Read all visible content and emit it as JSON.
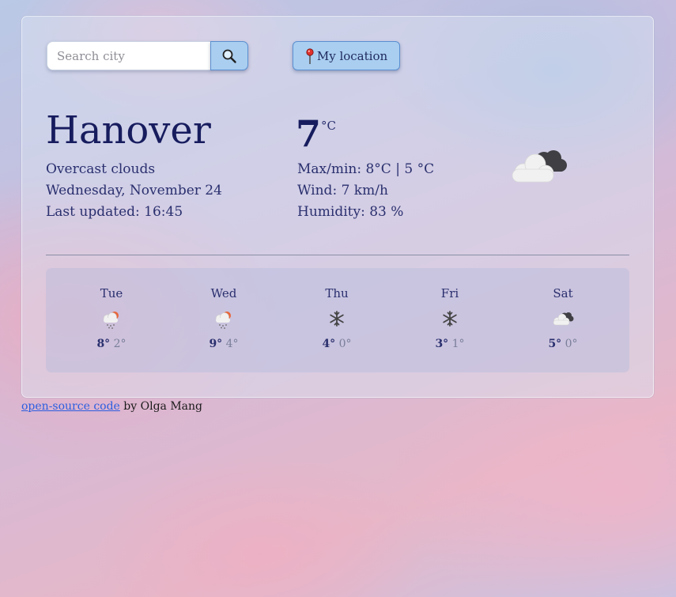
{
  "search": {
    "placeholder": "Search city",
    "value": "",
    "button_icon": "search-icon"
  },
  "location_button": {
    "label": "My location",
    "icon": "pin-icon"
  },
  "current": {
    "city": "Hanover",
    "description": "Overcast clouds",
    "date": "Wednesday, November 24",
    "last_updated": "Last updated: 16:45",
    "temperature": "7",
    "unit": "°C",
    "max_min": "Max/min: 8°C | 5 °C",
    "wind": "Wind: 7 km/h",
    "humidity": "Humidity: 83 %",
    "icon": "overcast-clouds-icon"
  },
  "forecast": [
    {
      "day": "Tue",
      "max": "8°",
      "min": "2°",
      "icon": "sleet-icon"
    },
    {
      "day": "Wed",
      "max": "9°",
      "min": "4°",
      "icon": "sleet-icon"
    },
    {
      "day": "Thu",
      "max": "4°",
      "min": "0°",
      "icon": "snowflake-icon"
    },
    {
      "day": "Fri",
      "max": "3°",
      "min": "1°",
      "icon": "snowflake-icon"
    },
    {
      "day": "Sat",
      "max": "5°",
      "min": "0°",
      "icon": "broken-clouds-icon"
    }
  ],
  "footer": {
    "link_text": "open-source code",
    "suffix": " by Olga Mang"
  },
  "colors": {
    "accent_button": "#a9cef0",
    "button_border": "#5b8fd0",
    "text_dark": "#171c5e",
    "link": "#2b5ee0"
  }
}
